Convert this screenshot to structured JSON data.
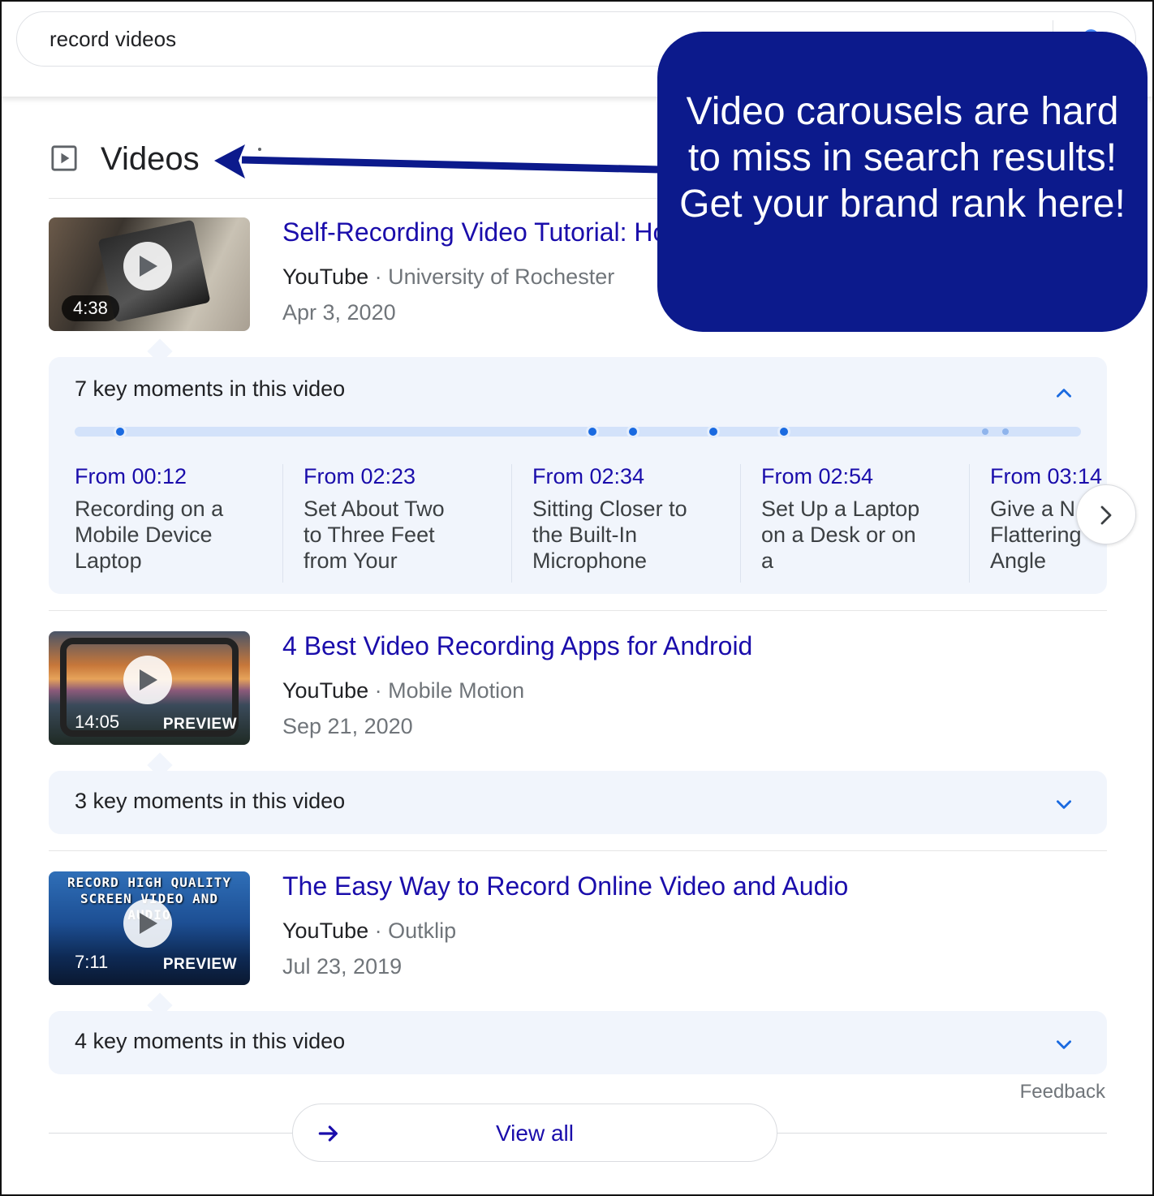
{
  "search": {
    "query": "record videos"
  },
  "section": {
    "title": "Videos"
  },
  "videos": [
    {
      "title": "Self-Recording Video Tutorial: Ho",
      "platform": "YouTube",
      "separator": " · ",
      "channel": "University of Rochester",
      "date": "Apr 3, 2020",
      "duration": "4:38",
      "key_moments_label": "7 key moments in this video",
      "expanded": true
    },
    {
      "title": "4 Best Video Recording Apps for Android",
      "platform": "YouTube",
      "separator": " · ",
      "channel": "Mobile Motion",
      "date": "Sep 21, 2020",
      "duration": "14:05",
      "preview": "PREVIEW",
      "key_moments_label": "3 key moments in this video",
      "expanded": false
    },
    {
      "title": "The Easy Way to Record Online Video and Audio",
      "platform": "YouTube",
      "separator": " · ",
      "channel": "Outklip",
      "date": "Jul 23, 2019",
      "duration": "7:11",
      "preview": "PREVIEW",
      "thumb_caption": "RECORD HIGH QUALITY SCREEN VIDEO AND AUDIO",
      "key_moments_label": "4 key moments in this video",
      "expanded": false
    }
  ],
  "key_moments": [
    {
      "time": "From 00:12",
      "label": "Recording on a Mobile Device Laptop"
    },
    {
      "time": "From 02:23",
      "label": "Set About Two to Three Feet from Your"
    },
    {
      "time": "From 02:34",
      "label": "Sitting Closer to the Built-In Microphone"
    },
    {
      "time": "From 02:54",
      "label": "Set Up a Laptop on a Desk or on a"
    },
    {
      "time": "From 03:14",
      "label": "Give a N Flattering Angle"
    }
  ],
  "footer": {
    "feedback": "Feedback",
    "view_all": "View all"
  },
  "callout": {
    "text": "Video carousels are hard to miss in search results! Get your brand rank here!",
    "color": "#0c1a8c"
  },
  "colors": {
    "link": "#1a0dab",
    "panel": "#f1f5fc",
    "accent": "#1a6ae0"
  }
}
